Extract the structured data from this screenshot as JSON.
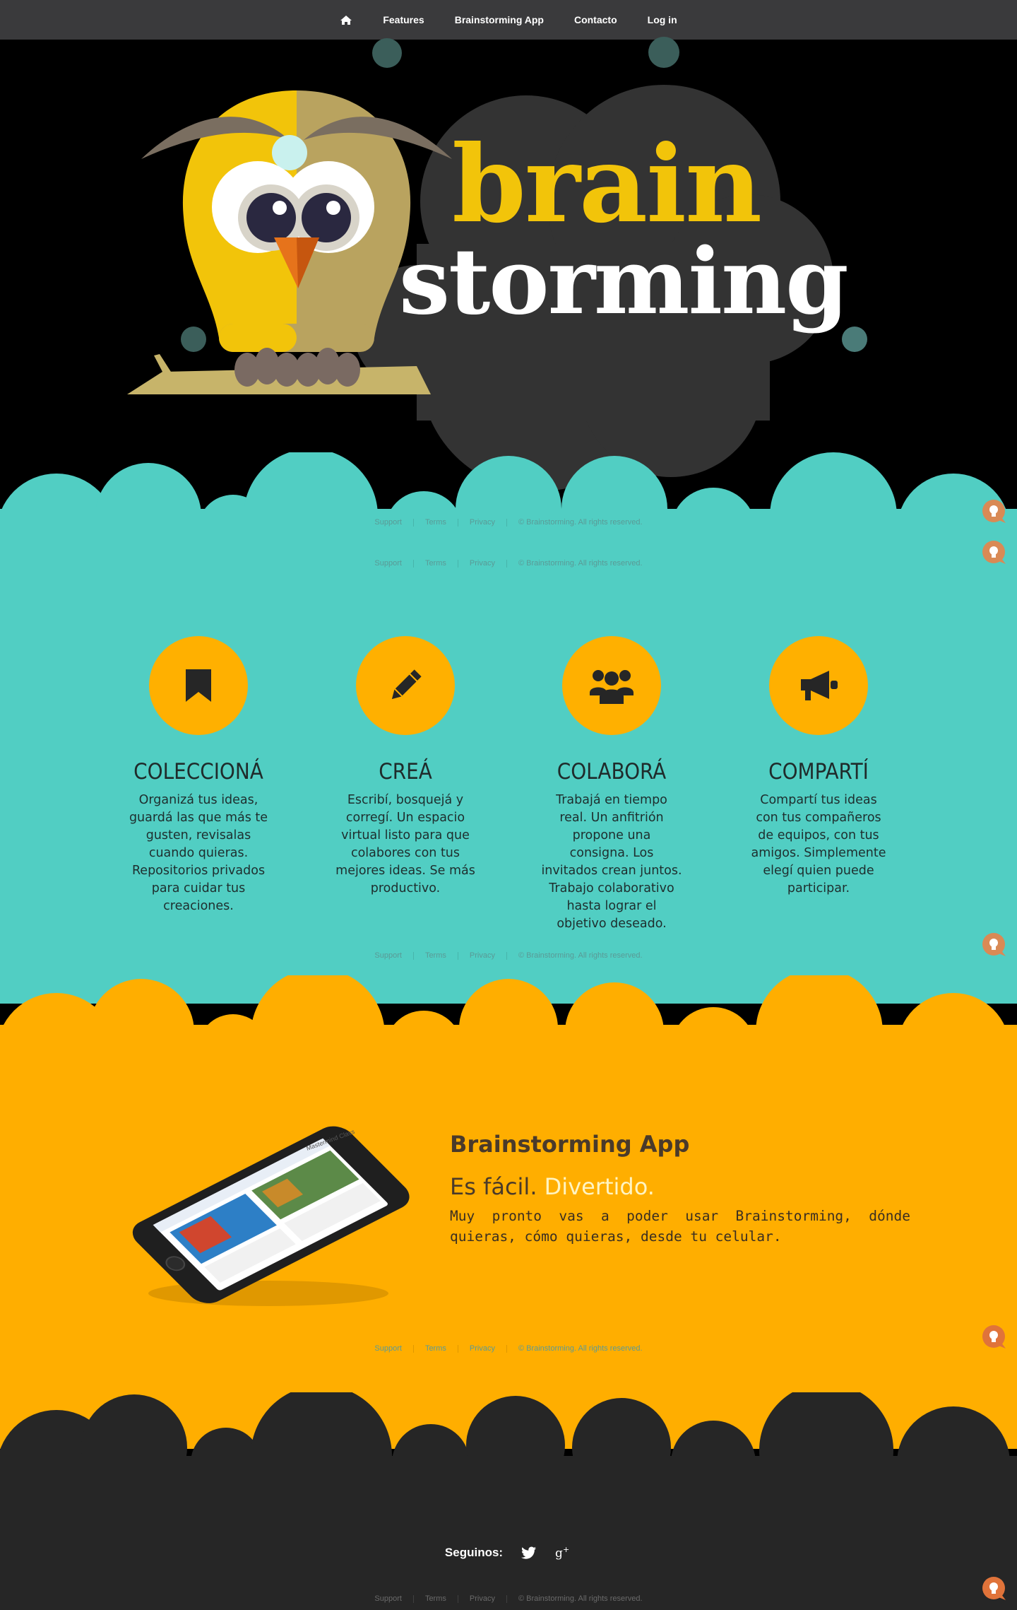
{
  "nav": {
    "home_icon": "home-icon",
    "items": [
      {
        "label": "Features"
      },
      {
        "label": "Brainstorming App"
      },
      {
        "label": "Contacto"
      },
      {
        "label": "Log in"
      }
    ]
  },
  "hero": {
    "logo_line1": "brain",
    "logo_line2": "storming"
  },
  "footer_links": {
    "support": "Support",
    "terms": "Terms",
    "privacy": "Privacy",
    "copyright": "© Brainstorming. All rights reserved."
  },
  "features": [
    {
      "icon": "bookmark-icon",
      "title": "COLECCIONÁ",
      "text": "Organizá tus ideas, guardá las que más te gusten, revisalas cuando quieras. Repositorios privados para cuidar tus creaciones."
    },
    {
      "icon": "pencil-icon",
      "title": "CREÁ",
      "text": "Escribí, bosquejá y corregí. Un espacio virtual listo para que colabores con tus mejores ideas. Se más productivo."
    },
    {
      "icon": "group-icon",
      "title": "COLABORÁ",
      "text": "Trabajá en tiempo real. Un anfitrión propone una consigna. Los invitados crean juntos. Trabajo colaborativo hasta lograr el objetivo deseado."
    },
    {
      "icon": "megaphone-icon",
      "title": "COMPARTÍ",
      "text": "Compartí tus ideas con tus compañeros de equipos, con tus amigos. Simplemente elegí quien puede participar."
    }
  ],
  "app": {
    "title": "Brainstorming App",
    "sub_plain": "Es fácil.",
    "sub_highlight": "Divertido.",
    "description": "Muy pronto vas a poder usar Brainstorming, dónde quieras, cómo quieras, desde tu celular.",
    "phone_screen_title": "Mastermind Class"
  },
  "footer": {
    "follow_label": "Seguinos:",
    "social": [
      "twitter-icon",
      "google-plus-icon"
    ]
  },
  "colors": {
    "teal": "#51cec3",
    "orange": "#ffae00",
    "dark": "#262626",
    "logo_yellow": "#f2c40a"
  }
}
